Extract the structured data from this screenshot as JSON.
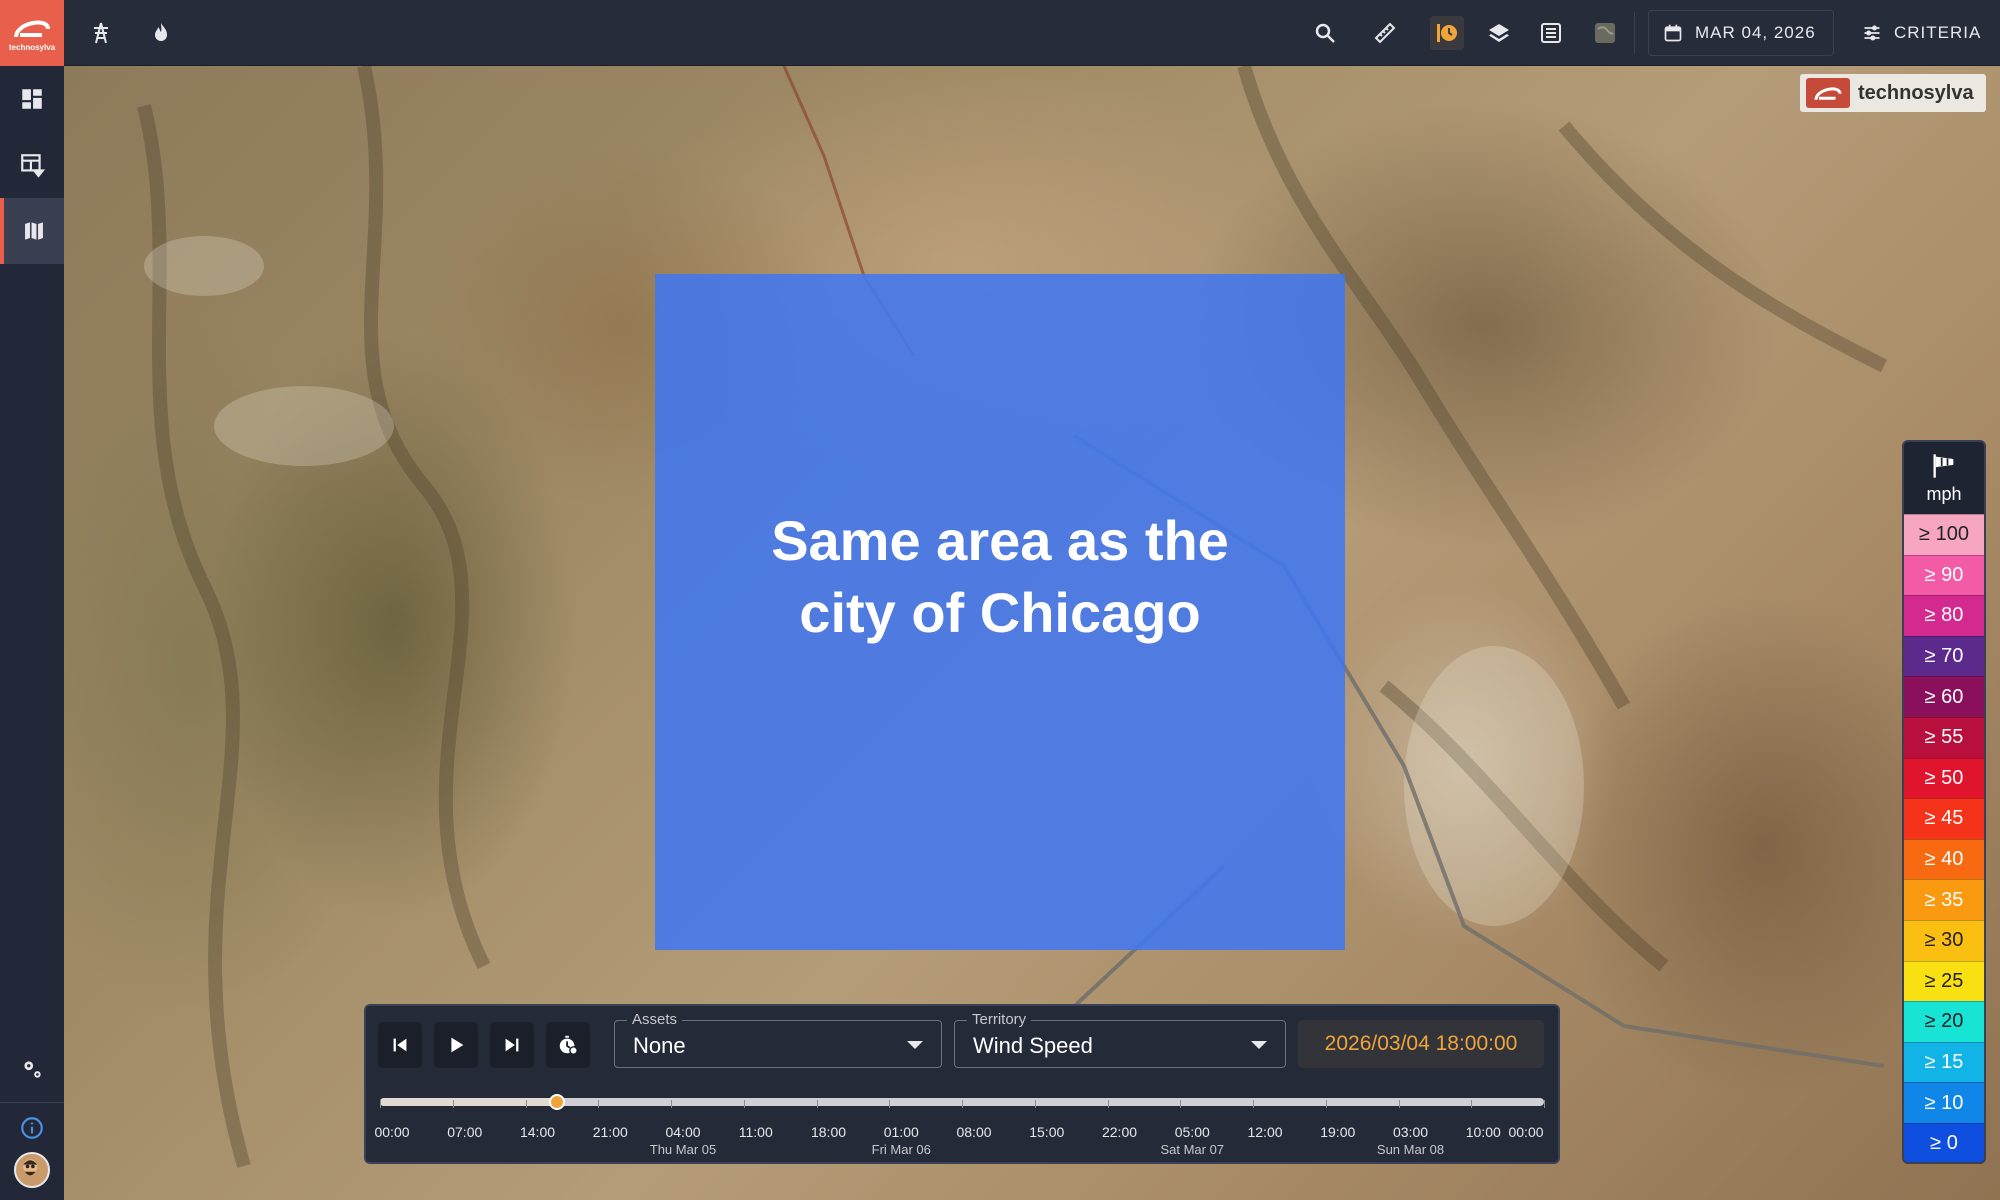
{
  "brand": {
    "logo_text": "technosylva",
    "watermark_text": "technosylva"
  },
  "topbar": {
    "icons": [
      "transmission-tower-icon",
      "fire-icon"
    ],
    "tools": [
      "search-icon",
      "ruler-icon",
      "history-clock-icon",
      "layers-icon",
      "list-icon",
      "satellite-icon"
    ],
    "date_label": "MAR 04, 2026",
    "criteria_label": "CRITERIA"
  },
  "sidebar": {
    "items": [
      "dashboard-icon",
      "table-filter-icon",
      "map-icon"
    ],
    "bottom": [
      "settings-icon",
      "info-icon"
    ]
  },
  "overlay": {
    "text": "Same area as the city of Chicago"
  },
  "legend": {
    "icon": "windsock-icon",
    "unit": "mph",
    "rows": [
      {
        "label": "≥ 100",
        "color": "#f7a6c1",
        "text_color": "#222222"
      },
      {
        "label": "≥ 90",
        "color": "#f45ba7",
        "text_color": "#ffffff"
      },
      {
        "label": "≥ 80",
        "color": "#d42a8f",
        "text_color": "#ffffff"
      },
      {
        "label": "≥ 70",
        "color": "#5b2a8c",
        "text_color": "#ffffff"
      },
      {
        "label": "≥ 60",
        "color": "#8a0f5c",
        "text_color": "#ffffff"
      },
      {
        "label": "≥ 55",
        "color": "#b80f3c",
        "text_color": "#ffffff"
      },
      {
        "label": "≥ 50",
        "color": "#e0142c",
        "text_color": "#ffffff"
      },
      {
        "label": "≥ 45",
        "color": "#f5331a",
        "text_color": "#ffffff"
      },
      {
        "label": "≥ 40",
        "color": "#f86a12",
        "text_color": "#ffffff"
      },
      {
        "label": "≥ 35",
        "color": "#fa9a10",
        "text_color": "#ffffff"
      },
      {
        "label": "≥ 30",
        "color": "#fbbf12",
        "text_color": "#222222"
      },
      {
        "label": "≥ 25",
        "color": "#f8e012",
        "text_color": "#222222"
      },
      {
        "label": "≥ 20",
        "color": "#18e4d6",
        "text_color": "#222222"
      },
      {
        "label": "≥ 15",
        "color": "#12b4e8",
        "text_color": "#ffffff"
      },
      {
        "label": "≥ 10",
        "color": "#0f86e8",
        "text_color": "#ffffff"
      },
      {
        "label": "≥ 0",
        "color": "#0f4fe0",
        "text_color": "#ffffff"
      }
    ]
  },
  "controls": {
    "buttons": [
      "skip-back-icon",
      "play-icon",
      "skip-forward-icon",
      "timer-settings-icon"
    ],
    "assets": {
      "label": "Assets",
      "value": "None"
    },
    "territory": {
      "label": "Territory",
      "value": "Wind Speed"
    },
    "datetime": "2026/03/04 18:00:00",
    "timeline": {
      "progress": 0.152,
      "ticks": [
        "00:00",
        "07:00",
        "14:00",
        "21:00",
        "04:00",
        "11:00",
        "18:00",
        "01:00",
        "08:00",
        "15:00",
        "22:00",
        "05:00",
        "12:00",
        "19:00",
        "03:00",
        "10:00",
        "00:00"
      ],
      "days": [
        {
          "label": "Thu Mar 05",
          "tick_index": 4
        },
        {
          "label": "Fri Mar 06",
          "tick_index": 7
        },
        {
          "label": "Sat Mar 07",
          "tick_index": 11
        },
        {
          "label": "Sun Mar 08",
          "tick_index": 14
        }
      ]
    }
  }
}
